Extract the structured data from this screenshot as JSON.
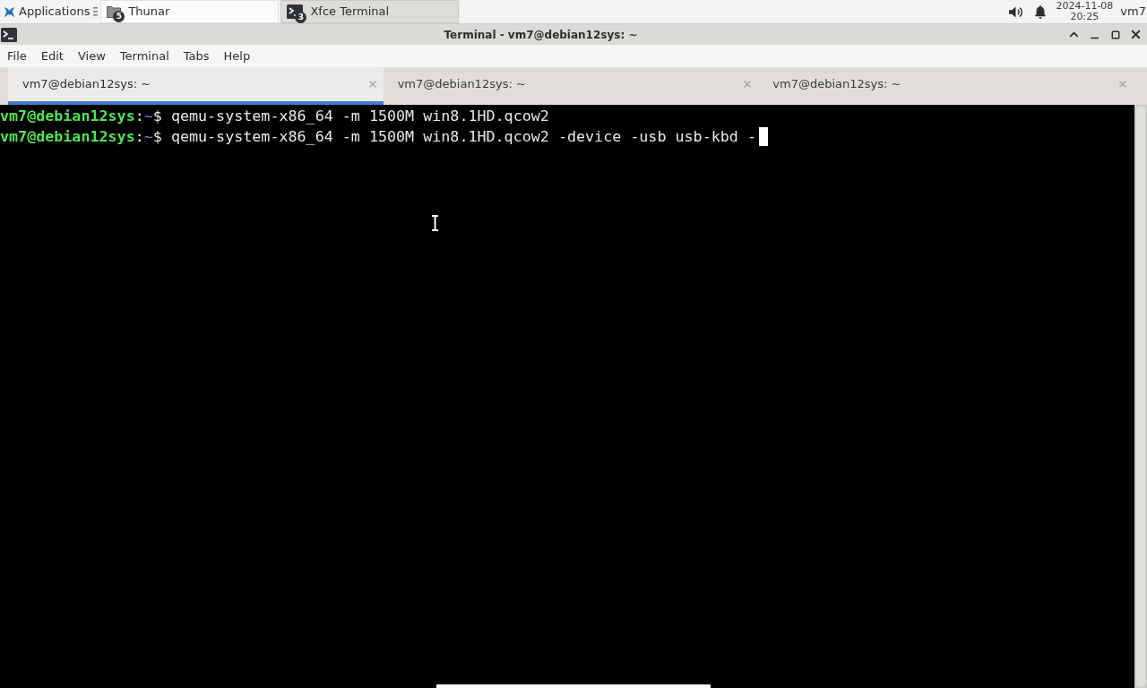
{
  "panel": {
    "applications": {
      "label": "Applications"
    },
    "tasks": [
      {
        "label": "Thunar",
        "kind": "folder",
        "count": "5",
        "selected": false
      },
      {
        "label": "Xfce Terminal",
        "kind": "terminal",
        "count": "3",
        "selected": true
      }
    ],
    "clock": {
      "date": "2024-11-08",
      "time": "20:25"
    },
    "user": "vm7"
  },
  "window": {
    "title": "Terminal - vm7@debian12sys: ~"
  },
  "menu": [
    "File",
    "Edit",
    "View",
    "Terminal",
    "Tabs",
    "Help"
  ],
  "tabs": [
    {
      "label": "vm7@debian12sys: ~",
      "selected": true
    },
    {
      "label": "vm7@debian12sys: ~",
      "selected": false
    },
    {
      "label": "vm7@debian12sys: ~",
      "selected": false
    }
  ],
  "terminal": {
    "lines": [
      {
        "user_host": "vm7@debian12sys",
        "separator": ":",
        "path": "~",
        "symbol": "$",
        "command": " qemu-system-x86_64 -m 1500M win8.1HD.qcow2",
        "cursor": false
      },
      {
        "user_host": "vm7@debian12sys",
        "separator": ":",
        "path": "~",
        "symbol": "$",
        "command": " qemu-system-x86_64 -m 1500M win8.1HD.qcow2 -device -usb usb-kbd -",
        "cursor": true
      }
    ]
  }
}
